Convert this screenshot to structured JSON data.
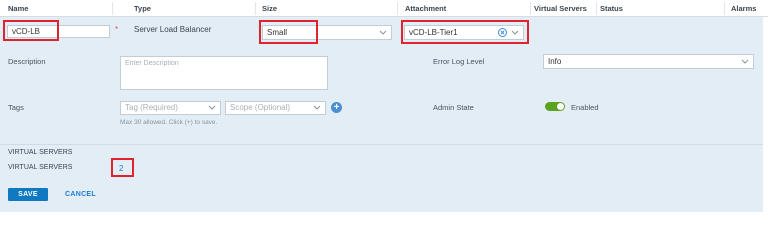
{
  "table": {
    "columns": [
      "Name",
      "Type",
      "Size",
      "Attachment",
      "Virtual Servers",
      "Status",
      "Alarms"
    ]
  },
  "row": {
    "name_value": "vCD-LB",
    "required_mark": "*",
    "type_value": "Server Load Balancer",
    "size_value": "Small",
    "attachment_value": "vCD-LB-Tier1"
  },
  "form": {
    "description_label": "Description",
    "description_placeholder": "Enter Description",
    "tags_label": "Tags",
    "tag_placeholder": "Tag (Required)",
    "scope_placeholder": "Scope (Optional)",
    "tags_hint": "Max 30 allowed. Click (+) to save.",
    "error_log_label": "Error Log Level",
    "error_log_value": "Info",
    "admin_state_label": "Admin State",
    "admin_state_value": "Enabled",
    "admin_state_on": true
  },
  "virtual_servers": {
    "section_title": "VIRTUAL SERVERS",
    "label": "VIRTUAL SERVERS",
    "count": "2"
  },
  "actions": {
    "save": "SAVE",
    "cancel": "CANCEL"
  },
  "colors": {
    "panel_bg": "#e3edf5",
    "highlight": "#e0242e",
    "primary": "#0f79c2",
    "toggle_on": "#5aa220"
  }
}
